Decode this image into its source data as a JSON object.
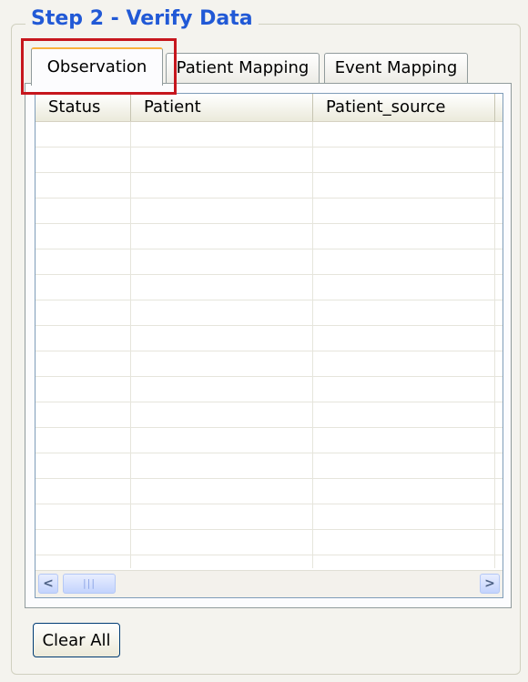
{
  "group": {
    "title": "Step 2 - Verify Data"
  },
  "tabs": [
    {
      "label": "Observation",
      "active": true
    },
    {
      "label": "Patient Mapping",
      "active": false
    },
    {
      "label": "Event Mapping",
      "active": false
    }
  ],
  "grid": {
    "columns": [
      "Status",
      "Patient",
      "Patient_source"
    ],
    "visible_row_count": 17
  },
  "scrollbar": {
    "left_arrow": "<",
    "right_arrow": ">",
    "thumb_grip": "|||"
  },
  "buttons": {
    "clear_all": "Clear All"
  },
  "colors": {
    "title": "#2159d6",
    "highlight": "#c6161d",
    "tab_active_accent": "#f9b03b"
  }
}
